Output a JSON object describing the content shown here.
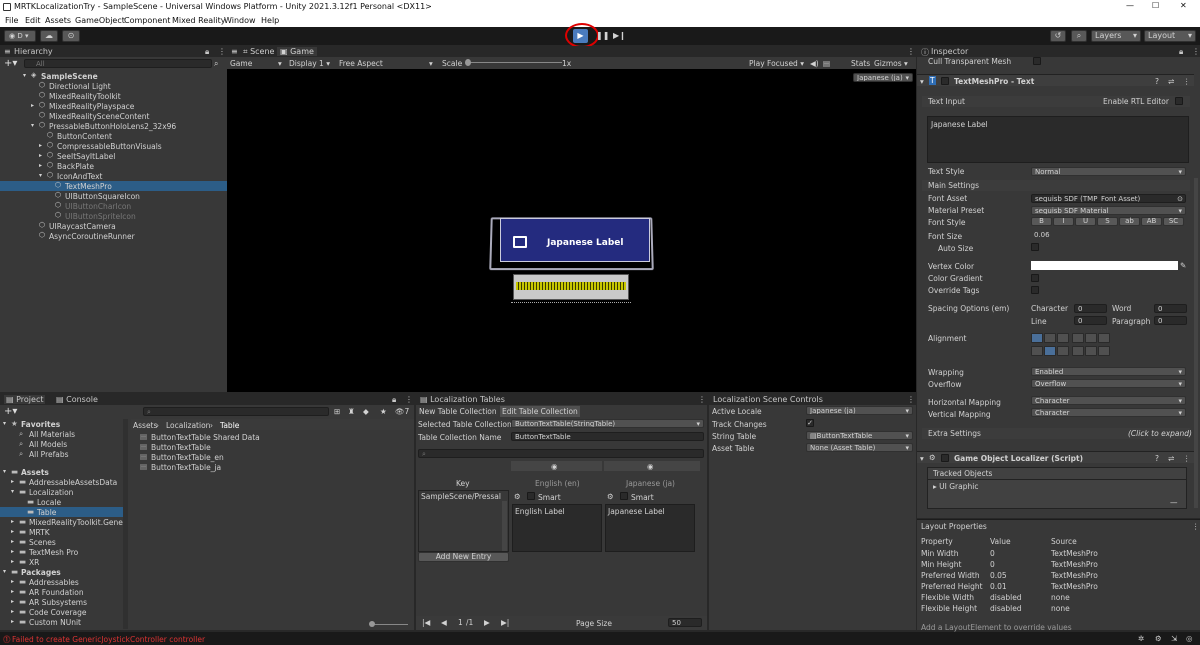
{
  "title": "MRTKLocalizationTry - SampleScene - Universal Windows Platform - Unity 2021.3.12f1 Personal <DX11>",
  "menu": [
    "File",
    "Edit",
    "Assets",
    "GameObject",
    "Component",
    "Mixed Reality",
    "Window",
    "Help"
  ],
  "toolbar": {
    "account": "D",
    "layers": "Layers",
    "layout": "Layout"
  },
  "hierarchy": {
    "title": "Hierarchy",
    "search": "All",
    "items": [
      "SampleScene",
      "Directional Light",
      "MixedRealityToolkit",
      "MixedRealityPlayspace",
      "MixedRealitySceneContent",
      "PressableButtonHoloLens2_32x96",
      "ButtonContent",
      "CompressableButtonVisuals",
      "SeeItSayItLabel",
      "BackPlate",
      "IconAndText",
      "TextMeshPro",
      "UIButtonSquareIcon",
      "UIButtonCharIcon",
      "UIButtonSpriteIcon",
      "UIRaycastCamera",
      "AsyncCoroutineRunner"
    ]
  },
  "game": {
    "tabs": [
      "Scene",
      "Game"
    ],
    "mode": "Game",
    "display": "Display 1",
    "aspect": "Free Aspect",
    "scale_label": "Scale",
    "scale_value": "1x",
    "play_focused": "Play Focused",
    "stats": "Stats",
    "gizmos": "Gizmos",
    "locale": "Japanese (ja)",
    "button_label": "Japanese Label"
  },
  "inspector": {
    "title": "Inspector",
    "cull": "Cull Transparent Mesh",
    "component": "TextMeshPro - Text",
    "text_input": "Text Input",
    "rtl": "Enable RTL Editor",
    "text_value": "Japanese Label",
    "text_style_label": "Text Style",
    "text_style": "Normal",
    "main_settings": "Main Settings",
    "font_asset_label": "Font Asset",
    "font_asset": "seguisb SDF (TMP_Font Asset)",
    "material_label": "Material Preset",
    "material": "seguisb SDF Material",
    "font_style_label": "Font Style",
    "font_styles": [
      "B",
      "I",
      "U",
      "S",
      "ab",
      "AB",
      "SC"
    ],
    "font_size_label": "Font Size",
    "font_size": "0.06",
    "auto_size": "Auto Size",
    "vertex_color": "Vertex Color",
    "color_gradient": "Color Gradient",
    "override_tags": "Override Tags",
    "spacing": "Spacing Options (em)",
    "character": "Character",
    "character_val": "0",
    "word": "Word",
    "word_val": "0",
    "line": "Line",
    "line_val": "0",
    "paragraph": "Paragraph",
    "paragraph_val": "0",
    "alignment": "Alignment",
    "wrapping_label": "Wrapping",
    "wrapping": "Enabled",
    "overflow_label": "Overflow",
    "overflow": "Overflow",
    "hmap_label": "Horizontal Mapping",
    "hmap": "Character",
    "vmap_label": "Vertical Mapping",
    "vmap": "Character",
    "extra": "Extra Settings",
    "extra_hint": "(Click to expand)",
    "localizer": "Game Object Localizer (Script)",
    "tracked": "Tracked Objects",
    "ui_graphic": "UI Graphic"
  },
  "layout_props": {
    "title": "Layout Properties",
    "headers": [
      "Property",
      "Value",
      "Source"
    ],
    "rows": [
      [
        "Min Width",
        "0",
        "TextMeshPro"
      ],
      [
        "Min Height",
        "0",
        "TextMeshPro"
      ],
      [
        "Preferred Width",
        "0.05",
        "TextMeshPro"
      ],
      [
        "Preferred Height",
        "0.01",
        "TextMeshPro"
      ],
      [
        "Flexible Width",
        "disabled",
        "none"
      ],
      [
        "Flexible Height",
        "disabled",
        "none"
      ]
    ],
    "footer": "Add a LayoutElement to override values"
  },
  "project": {
    "tabs": [
      "Project",
      "Console"
    ],
    "favorites": "Favorites",
    "fav_items": [
      "All Materials",
      "All Models",
      "All Prefabs"
    ],
    "assets": "Assets",
    "tree": [
      "AddressableAssetsData",
      "Localization",
      "Locale",
      "Table",
      "MixedRealityToolkit.Gene",
      "MRTK",
      "Scenes",
      "TextMesh Pro",
      "XR"
    ],
    "packages": "Packages",
    "pkg_items": [
      "Addressables",
      "AR Foundation",
      "AR Subsystems",
      "Code Coverage",
      "Custom NUnit"
    ],
    "breadcrumb": [
      "Assets",
      "Localization",
      "Table"
    ],
    "files": [
      "ButtonTextTable Shared Data",
      "ButtonTextTable",
      "ButtonTextTable_en",
      "ButtonTextTable_ja"
    ],
    "count": "7"
  },
  "loc_tables": {
    "title": "Localization Tables",
    "tabs": [
      "New Table Collection",
      "Edit Table Collection"
    ],
    "sel_label": "Selected Table Collection",
    "sel_value": "ButtonTextTable(StringTable)",
    "name_label": "Table Collection Name",
    "name_value": "ButtonTextTable",
    "key": "Key",
    "en": "English (en)",
    "ja": "Japanese (ja)",
    "smart": "Smart",
    "entry_key": "SampleScene/Pressal",
    "en_val": "English Label",
    "ja_val": "Japanese Label",
    "add": "Add New Entry",
    "page": "1",
    "pages": "/1",
    "page_size": "Page Size",
    "page_size_val": "50"
  },
  "scene_controls": {
    "title": "Localization Scene Controls",
    "active_locale_label": "Active Locale",
    "active_locale": "Japanese (ja)",
    "track_label": "Track Changes",
    "string_label": "String Table",
    "string_value": "ButtonTextTable",
    "asset_label": "Asset Table",
    "asset_value": "None (Asset Table)"
  },
  "status": "Failed to create GenericJoystickController controller"
}
